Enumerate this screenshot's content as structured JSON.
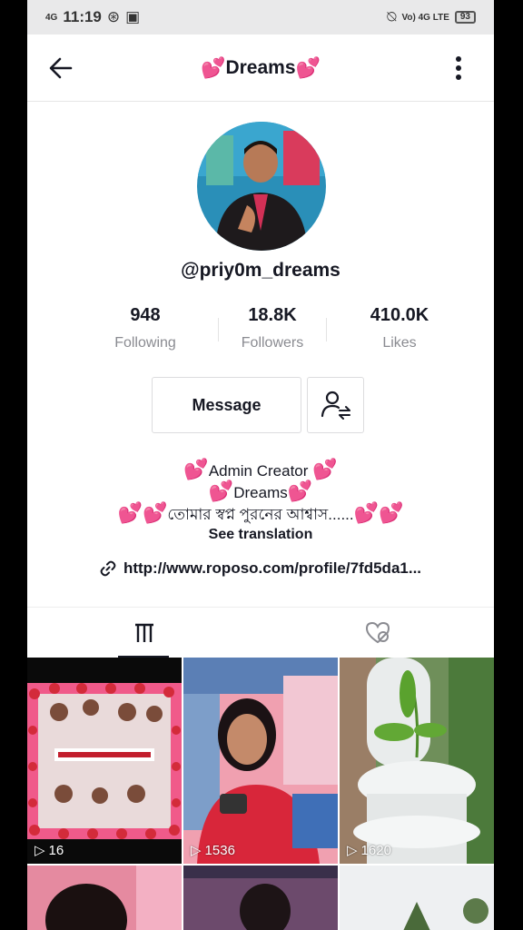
{
  "status_bar": {
    "network": "4G",
    "time": "11:19",
    "volte": "Vo) 4G LTE",
    "battery": "93"
  },
  "header": {
    "title": "Dreams",
    "title_heart_glyph": "💕"
  },
  "profile": {
    "username": "@priy0m_dreams",
    "stats": [
      {
        "value": "948",
        "label": "Following"
      },
      {
        "value": "18.8K",
        "label": "Followers"
      },
      {
        "value": "410.0K",
        "label": "Likes"
      }
    ],
    "message_label": "Message",
    "bio": {
      "line1": "Admin Creator",
      "line2": "Dreams",
      "line3": "তোমার স্বপ্ন পুরনের আশ্বাস......",
      "see_translation": "See translation"
    },
    "link": "http://www.roposo.com/profile/7fd5da1..."
  },
  "tabs": [
    {
      "icon": "videos-grid-icon",
      "active": true
    },
    {
      "icon": "liked-videos-icon",
      "active": false
    }
  ],
  "videos": [
    {
      "views": "16",
      "theme": "collage"
    },
    {
      "views": "1536",
      "theme": "portrait"
    },
    {
      "views": "1620",
      "theme": "plant"
    },
    {
      "views": "",
      "theme": "face"
    },
    {
      "views": "",
      "theme": "portrait2"
    },
    {
      "views": "",
      "theme": "sky"
    }
  ],
  "colors": {
    "accent_heart": "#e0243c",
    "text_primary": "#161823",
    "text_secondary": "#8a8b91"
  }
}
